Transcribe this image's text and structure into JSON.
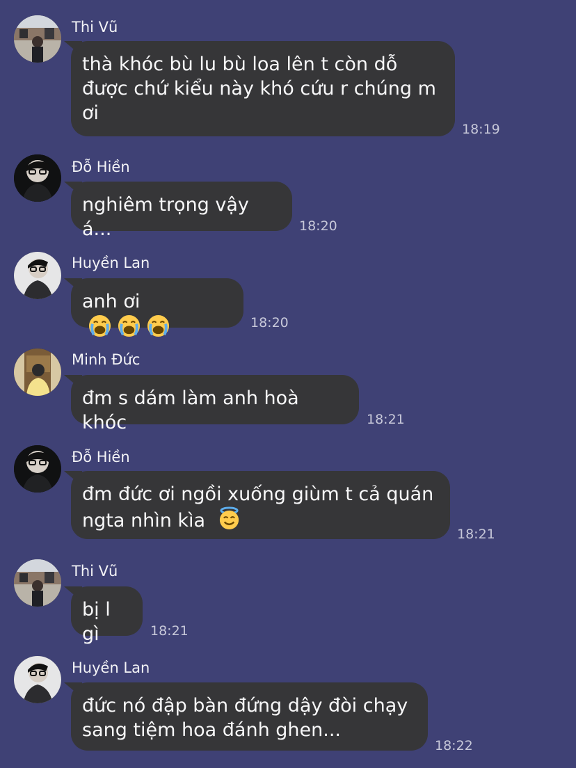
{
  "messages": [
    {
      "sender": "Thi Vũ",
      "text": "thà khóc bù lu bù loa lên t còn dỗ được chứ kiểu này khó cứu r chúng m ơi",
      "time": "18:19",
      "avatar": "avatar-thi-vu"
    },
    {
      "sender": "Đỗ Hiền",
      "text": "nghiêm trọng vậy á...",
      "time": "18:20",
      "avatar": "avatar-do-hien"
    },
    {
      "sender": "Huyền Lan",
      "text": "anh ơi",
      "time": "18:20",
      "avatar": "avatar-huyen-lan",
      "emojis": [
        "loudly-crying-face",
        "loudly-crying-face",
        "loudly-crying-face"
      ]
    },
    {
      "sender": "Minh Đức",
      "text": "đm s dám làm anh hoà khóc",
      "time": "18:21",
      "avatar": "avatar-minh-duc"
    },
    {
      "sender": "Đỗ Hiền",
      "text": "đm đức ơi ngồi xuống giùm t cả quán ngta nhìn kìa",
      "time": "18:21",
      "avatar": "avatar-do-hien",
      "emojis": [
        "smiling-face-with-halo"
      ]
    },
    {
      "sender": "Thi Vũ",
      "text": "bị l gì",
      "time": "18:21",
      "avatar": "avatar-thi-vu"
    },
    {
      "sender": "Huyền Lan",
      "text": "đức nó đập bàn đứng dậy đòi chạy sang tiệm hoa đánh ghen...",
      "time": "18:22",
      "avatar": "avatar-huyen-lan"
    }
  ],
  "colors": {
    "background": "#3f4175",
    "bubble": "#363638",
    "timestamp": "#c7c8d9"
  }
}
